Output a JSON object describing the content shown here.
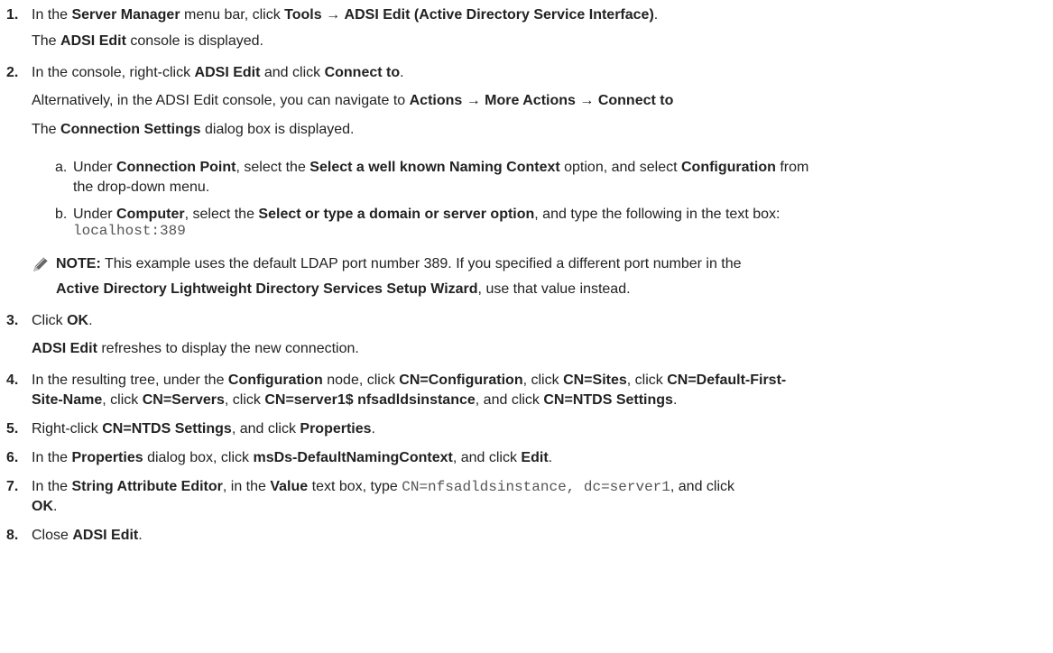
{
  "steps": [
    {
      "num": "1.",
      "lines": [
        [
          [
            "In the ",
            false
          ],
          [
            "Server Manager",
            true
          ],
          [
            " menu bar, click ",
            false
          ],
          [
            "Tools",
            true
          ],
          [
            " → ",
            false
          ],
          [
            "ADSI Edit (Active Directory Service Interface)",
            true
          ],
          [
            ".",
            false
          ]
        ],
        [
          [
            "The ",
            false
          ],
          [
            "ADSI Edit",
            true
          ],
          [
            " console is displayed.",
            false
          ]
        ]
      ]
    },
    {
      "num": "2.",
      "lines": [
        [
          [
            "In the console, right-click ",
            false
          ],
          [
            "ADSI Edit",
            true
          ],
          [
            " and click ",
            false
          ],
          [
            "Connect to",
            true
          ],
          [
            ".",
            false
          ]
        ],
        [
          [
            "Alternatively, in the ADSI Edit console, you can navigate to ",
            false
          ],
          [
            "Actions",
            true
          ],
          [
            " → ",
            false
          ],
          [
            "More Actions",
            true
          ],
          [
            " → ",
            false
          ],
          [
            "Connect to",
            true
          ]
        ],
        [
          [
            "The ",
            false
          ],
          [
            "Connection Settings",
            true
          ],
          [
            " dialog box is displayed.",
            false
          ]
        ]
      ]
    },
    {
      "num": "3.",
      "lines": [
        [
          [
            "Click ",
            false
          ],
          [
            "OK",
            true
          ],
          [
            ".",
            false
          ]
        ],
        [
          [
            "ADSI Edit",
            true
          ],
          [
            " refreshes to display the new connection.",
            false
          ]
        ]
      ]
    },
    {
      "num": "4.",
      "lines": [
        [
          [
            "In the resulting tree, under the ",
            false
          ],
          [
            "Configuration",
            true
          ],
          [
            " node, click ",
            false
          ],
          [
            "CN=Configuration",
            true
          ],
          [
            ", click ",
            false
          ],
          [
            "CN=Sites",
            true
          ],
          [
            ", click ",
            false
          ],
          [
            "CN=Default-First-",
            true
          ]
        ],
        [
          [
            "Site-Name",
            true
          ],
          [
            ", click ",
            false
          ],
          [
            "CN=Servers",
            true
          ],
          [
            ", click ",
            false
          ],
          [
            "CN=server1$ nfsadldsinstance",
            true
          ],
          [
            ", and click ",
            false
          ],
          [
            "CN=NTDS Settings",
            true
          ],
          [
            ".",
            false
          ]
        ]
      ]
    },
    {
      "num": "5.",
      "lines": [
        [
          [
            "Right-click ",
            false
          ],
          [
            "CN=NTDS Settings",
            true
          ],
          [
            ", and click ",
            false
          ],
          [
            "Properties",
            true
          ],
          [
            ".",
            false
          ]
        ]
      ]
    },
    {
      "num": "6.",
      "lines": [
        [
          [
            "In the ",
            false
          ],
          [
            "Properties",
            true
          ],
          [
            " dialog box, click ",
            false
          ],
          [
            "msDs-DefaultNamingContext",
            true
          ],
          [
            ", and click ",
            false
          ],
          [
            "Edit",
            true
          ],
          [
            ".",
            false
          ]
        ]
      ]
    },
    {
      "num": "7.",
      "lines": [
        [
          [
            "In the ",
            false
          ],
          [
            "String Attribute Editor",
            true
          ],
          [
            ", in the ",
            false
          ],
          [
            "Value",
            true
          ],
          [
            " text box, type ",
            false
          ],
          [
            "CN=nfsadldsinstance, dc=server1",
            "mono"
          ],
          [
            ", and click",
            false
          ]
        ],
        [
          [
            "OK",
            true
          ],
          [
            ".",
            false
          ]
        ]
      ]
    },
    {
      "num": "8.",
      "lines": [
        [
          [
            "Close ",
            false
          ],
          [
            "ADSI Edit",
            true
          ],
          [
            ".",
            false
          ]
        ]
      ]
    }
  ],
  "substeps": [
    {
      "letter": "a.",
      "lines": [
        [
          [
            "Under ",
            false
          ],
          [
            "Connection Point",
            true
          ],
          [
            ", select the ",
            false
          ],
          [
            "Select a well known Naming Context",
            true
          ],
          [
            " option, and select ",
            false
          ],
          [
            "Configuration",
            true
          ],
          [
            " from",
            false
          ]
        ],
        [
          [
            "the drop-down menu.",
            false
          ]
        ]
      ]
    },
    {
      "letter": "b.",
      "lines": [
        [
          [
            "Under ",
            false
          ],
          [
            "Computer",
            true
          ],
          [
            ", select the ",
            false
          ],
          [
            "Select or type a domain or server option",
            true
          ],
          [
            ", and type the following in the text box:",
            false
          ]
        ],
        [
          [
            "localhost:389",
            "mono"
          ]
        ]
      ]
    }
  ],
  "note": {
    "icon": "note-pencil-icon",
    "lines": [
      [
        [
          "NOTE:",
          true
        ],
        [
          " This example uses the default LDAP port number 389. If you specified a different port number in the",
          false
        ]
      ],
      [
        [
          "Active Directory Lightweight Directory Services Setup Wizard",
          true
        ],
        [
          ", use that value instead.",
          false
        ]
      ]
    ]
  }
}
